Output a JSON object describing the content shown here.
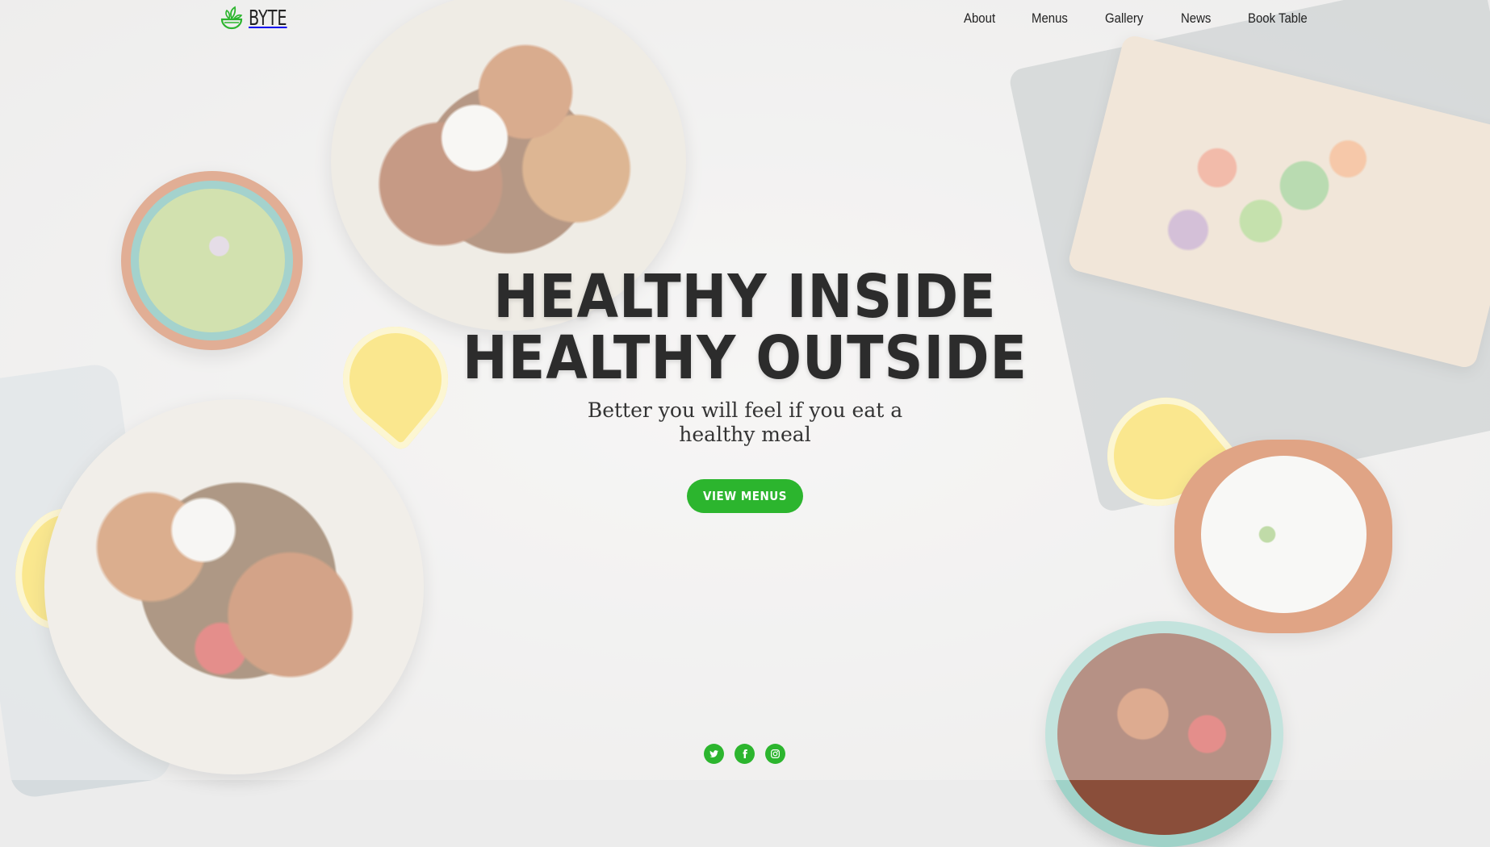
{
  "brand": {
    "name": "BYTE",
    "accent": "#2cb52e"
  },
  "nav": {
    "items": [
      {
        "label": "About"
      },
      {
        "label": "Menus"
      },
      {
        "label": "Gallery"
      },
      {
        "label": "News"
      },
      {
        "label": "Book Table"
      }
    ]
  },
  "hero": {
    "headline_line1": "HEALTHY INSIDE",
    "headline_line2": "HEALTHY OUTSIDE",
    "subheadline": "Better you will feel if you eat a healthy meal",
    "cta_label": "VIEW MENUS"
  },
  "social": {
    "icons": [
      "twitter-icon",
      "facebook-icon",
      "instagram-icon"
    ]
  }
}
